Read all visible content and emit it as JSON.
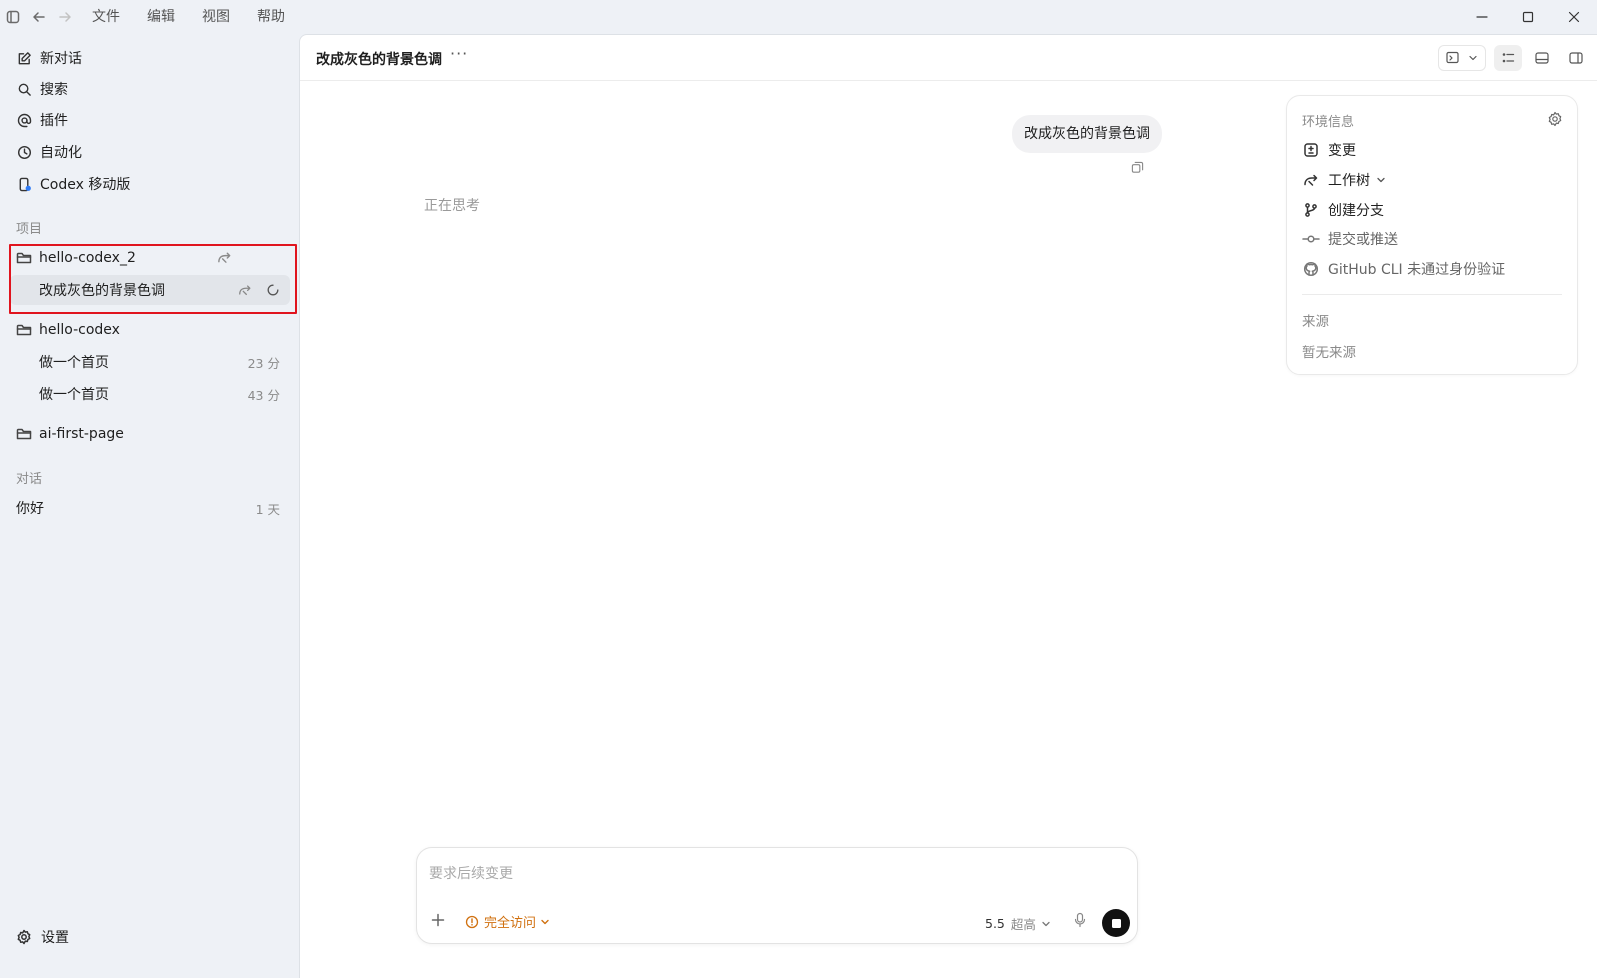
{
  "titlebar": {
    "menu": [
      "文件",
      "编辑",
      "视图",
      "帮助"
    ]
  },
  "sidebar": {
    "nav": [
      {
        "label": "新对话",
        "icon": "edit-icon"
      },
      {
        "label": "搜索",
        "icon": "search-icon"
      },
      {
        "label": "插件",
        "icon": "at-icon"
      },
      {
        "label": "自动化",
        "icon": "clock-icon"
      },
      {
        "label": "Codex 移动版",
        "icon": "phone-icon"
      }
    ],
    "projects_label": "项目",
    "projects": [
      {
        "name": "hello-codex_2",
        "threads": [
          {
            "title": "改成灰色的背景色调",
            "meta": ""
          }
        ]
      },
      {
        "name": "hello-codex",
        "threads": [
          {
            "title": "做一个首页",
            "meta": "23 分"
          },
          {
            "title": "做一个首页",
            "meta": "43 分"
          }
        ]
      },
      {
        "name": "ai-first-page",
        "threads": []
      }
    ],
    "chats_label": "对话",
    "chats": [
      {
        "title": "你好",
        "meta": "1 天"
      }
    ],
    "settings_label": "设置"
  },
  "main": {
    "title": "改成灰色的背景色调",
    "more_label": "···",
    "user_message": "改成灰色的背景色调",
    "status_text": "正在思考"
  },
  "env": {
    "title": "环境信息",
    "items": [
      {
        "label": "变更",
        "icon": "diff-icon"
      },
      {
        "label": "工作树",
        "icon": "worktree-icon"
      },
      {
        "label": "创建分支",
        "icon": "branch-icon"
      },
      {
        "label": "提交或推送",
        "icon": "commit-icon"
      },
      {
        "label": "GitHub CLI 未通过身份验证",
        "icon": "github-icon"
      }
    ],
    "source_label": "来源",
    "source_empty": "暂无来源"
  },
  "composer": {
    "placeholder": "要求后续变更",
    "access_label": "完全访问",
    "model": "5.5",
    "effort": "超高"
  },
  "colors": {
    "accent_orange": "#d0700f",
    "highlight_red": "#e0141e",
    "sidebar_bg": "#eef1f6"
  }
}
